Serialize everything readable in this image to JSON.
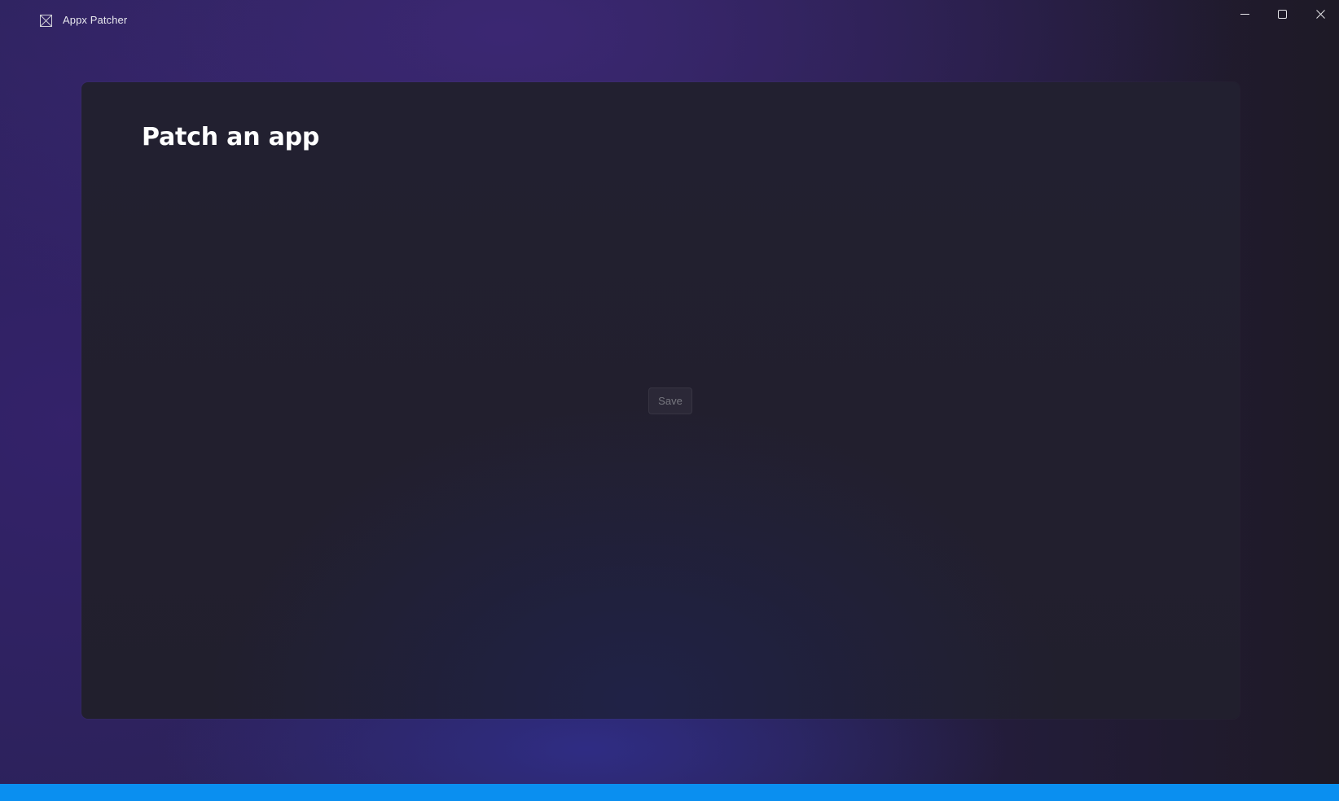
{
  "window": {
    "title": "Appx Patcher",
    "accent_color": "#0a8ff0"
  },
  "titlebar": {
    "app_icon": "placeholder-image-icon",
    "caption_buttons": {
      "minimize_icon": "minimize-icon",
      "maximize_icon": "maximize-icon",
      "close_icon": "close-icon"
    }
  },
  "main": {
    "page_title": "Patch an app",
    "save_label": "Save"
  }
}
